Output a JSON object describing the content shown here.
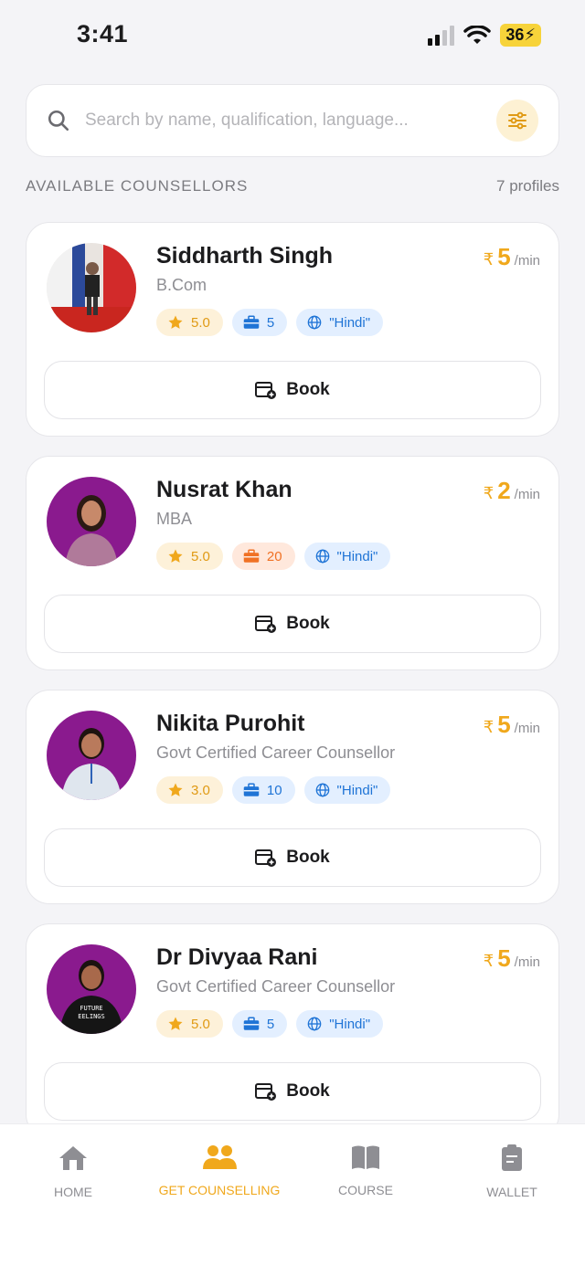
{
  "status_bar": {
    "time": "3:41",
    "battery": "36"
  },
  "search": {
    "placeholder": "Search by name, qualification, language..."
  },
  "section": {
    "title": "AVAILABLE COUNSELLORS",
    "count": "7 profiles"
  },
  "counsellors": [
    {
      "name": "Siddharth Singh",
      "qualification": "B.Com",
      "currency": "₹",
      "price": "5",
      "unit": "/min",
      "rating": "5.0",
      "experience": "5",
      "experience_color": "blue",
      "language": "\"Hindi\"",
      "book_label": "Book"
    },
    {
      "name": "Nusrat Khan",
      "qualification": "MBA",
      "currency": "₹",
      "price": "2",
      "unit": "/min",
      "rating": "5.0",
      "experience": "20",
      "experience_color": "orange",
      "language": "\"Hindi\"",
      "book_label": "Book"
    },
    {
      "name": "Nikita Purohit",
      "qualification": "Govt Certified Career Counsellor",
      "currency": "₹",
      "price": "5",
      "unit": "/min",
      "rating": "3.0",
      "experience": "10",
      "experience_color": "blue",
      "language": "\"Hindi\"",
      "book_label": "Book"
    },
    {
      "name": "Dr Divyaa Rani",
      "qualification": "Govt Certified Career Counsellor",
      "currency": "₹",
      "price": "5",
      "unit": "/min",
      "rating": "5.0",
      "experience": "5",
      "experience_color": "blue",
      "language": "\"Hindi\"",
      "book_label": "Book"
    }
  ],
  "tabs": [
    {
      "label": "HOME",
      "icon": "home-icon"
    },
    {
      "label": "GET COUNSELLING",
      "icon": "users-icon",
      "active": true
    },
    {
      "label": "COURSE",
      "icon": "book-icon"
    },
    {
      "label": "WALLET",
      "icon": "wallet-icon"
    }
  ],
  "colors": {
    "accent": "#f0a81c",
    "blue": "#1f74d6",
    "orange": "#f07124"
  }
}
